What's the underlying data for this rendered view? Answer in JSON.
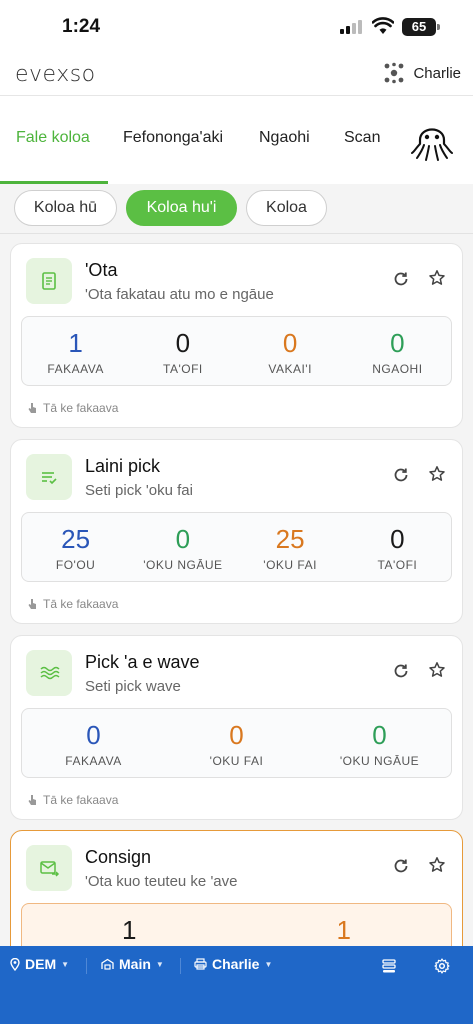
{
  "status_bar": {
    "time": "1:24",
    "battery": "65"
  },
  "header": {
    "logo": "evexso",
    "user_name": "Charlie"
  },
  "module_tabs": [
    {
      "label": "Fale koloa",
      "active": true
    },
    {
      "label": "Fefononga'aki",
      "active": false
    },
    {
      "label": "Ngaohi",
      "active": false
    },
    {
      "label": "Scan",
      "active": false
    }
  ],
  "segments": [
    {
      "label": "Koloa hū",
      "active": false
    },
    {
      "label": "Koloa hu'i",
      "active": true
    },
    {
      "label": "Koloa",
      "active": false
    }
  ],
  "cards": [
    {
      "title": "'Ota",
      "subtitle": "'Ota fakatau atu mo e ngāue",
      "icon": "document-icon",
      "stats": [
        {
          "value": "1",
          "label": "FAKAAVA",
          "color": "#2a56b8"
        },
        {
          "value": "0",
          "label": "TA'OFI",
          "color": "#1a1a1a"
        },
        {
          "value": "0",
          "label": "VAKAI'I",
          "color": "#d9781f"
        },
        {
          "value": "0",
          "label": "NGAOHI",
          "color": "#2e9e58"
        }
      ],
      "footer": "Tā ke fakaava"
    },
    {
      "title": "Laini pick",
      "subtitle": "Seti pick 'oku fai",
      "icon": "checklist-icon",
      "stats": [
        {
          "value": "25",
          "label": "FO'OU",
          "color": "#2a56b8"
        },
        {
          "value": "0",
          "label": "'OKU NGĀUE",
          "color": "#2e9e58"
        },
        {
          "value": "25",
          "label": "'OKU FAI",
          "color": "#d9781f"
        },
        {
          "value": "0",
          "label": "TA'OFI",
          "color": "#1a1a1a"
        }
      ],
      "footer": "Tā ke fakaava"
    },
    {
      "title": "Pick 'a e wave",
      "subtitle": "Seti pick wave",
      "icon": "wave-icon",
      "stats": [
        {
          "value": "0",
          "label": "FAKAAVA",
          "color": "#2a56b8"
        },
        {
          "value": "0",
          "label": "'OKU FAI",
          "color": "#d9781f"
        },
        {
          "value": "0",
          "label": "'OKU NGĀUE",
          "color": "#2e9e58"
        }
      ],
      "footer": "Tā ke fakaava"
    },
    {
      "title": "Consign",
      "subtitle": "'Ota kuo teuteu ke 'ave",
      "icon": "mail-arrow-icon",
      "stats": [
        {
          "value": "1",
          "label": "",
          "color": "#1a1a1a"
        },
        {
          "value": "1",
          "label": "",
          "color": "#d9781f"
        }
      ],
      "footer": ""
    }
  ],
  "bottom_bar": {
    "location": "DEM",
    "warehouse": "Main",
    "printer": "Charlie"
  }
}
